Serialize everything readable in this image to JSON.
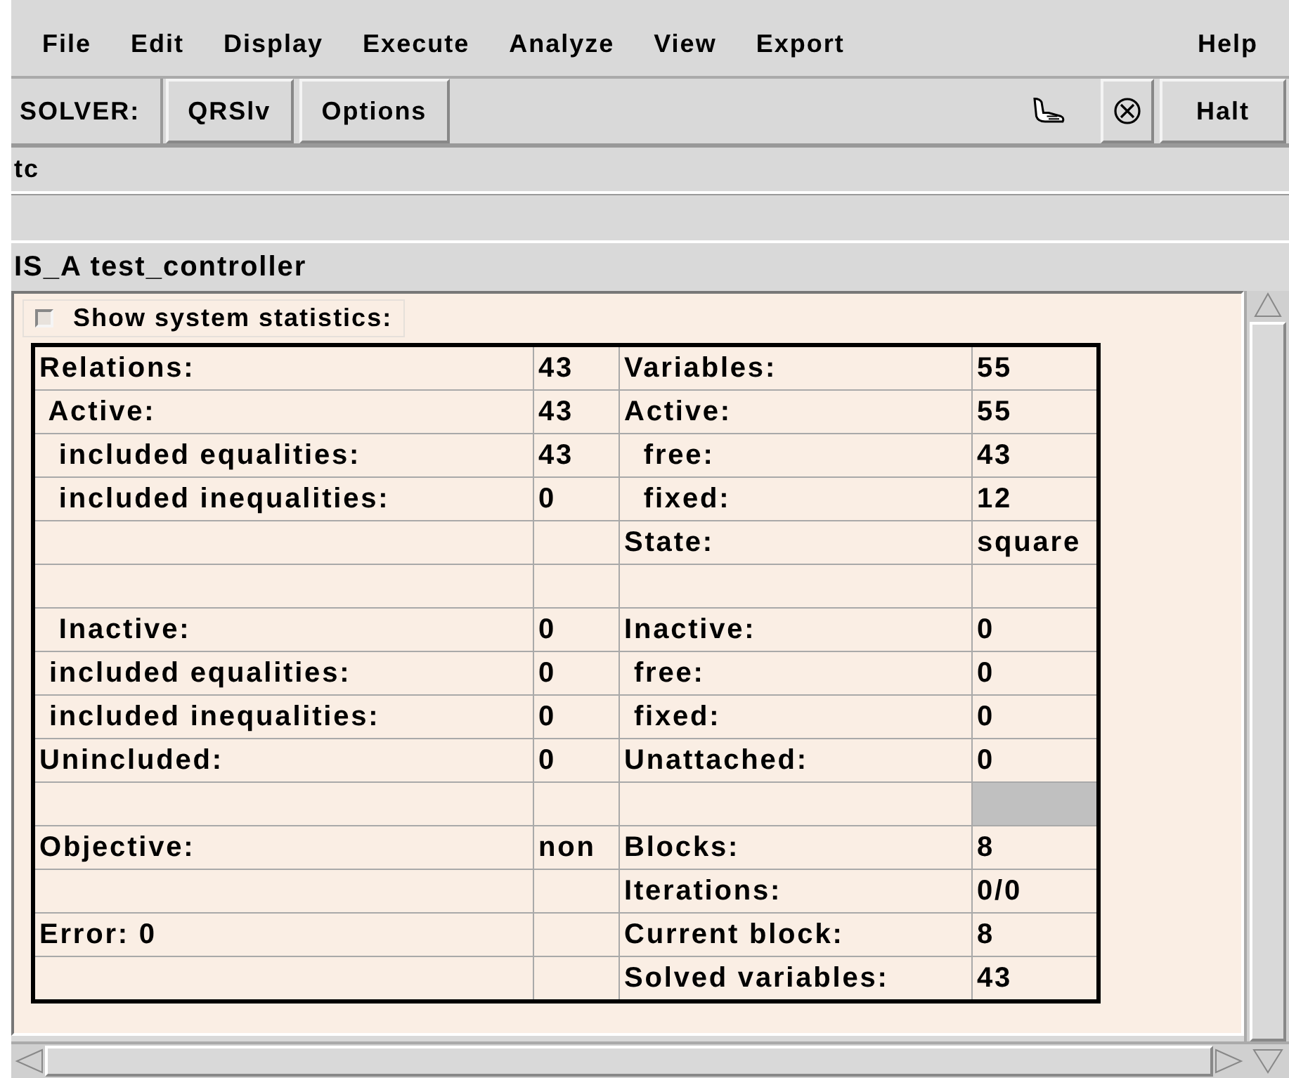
{
  "menu_bar": [
    "File",
    "Edit",
    "Display",
    "Execute",
    "Analyze",
    "View",
    "Export",
    "Help"
  ],
  "toolbar": {
    "label": "SOLVER:",
    "solver_button": "QRSlv",
    "options_button": "Options",
    "halt_button": "Halt"
  },
  "instance_field": {
    "value": "tc"
  },
  "type_line": "IS_A test_controller",
  "statistics": {
    "checkbox": {
      "label": "Show system statistics:",
      "checked": false
    },
    "rows": [
      {
        "cells": [
          "Relations:",
          "43",
          "Variables:",
          "55"
        ],
        "value_shaded": false
      },
      {
        "cells": [
          " Active:",
          "43",
          "Active:",
          "55"
        ],
        "value_shaded": false
      },
      {
        "cells": [
          "  included equalities:",
          "43",
          "  free:",
          "43"
        ],
        "value_shaded": false
      },
      {
        "cells": [
          "  included inequalities:",
          "0",
          "  fixed:",
          "12"
        ],
        "value_shaded": false
      },
      {
        "cells": [
          null,
          null,
          "State:",
          "square"
        ],
        "value_shaded": false
      },
      {
        "cells": [
          null,
          null,
          null,
          null
        ],
        "value_shaded": false
      },
      {
        "cells": [
          "  Inactive:",
          "0",
          "Inactive:",
          "0"
        ],
        "value_shaded": false
      },
      {
        "cells": [
          " included equalities:",
          "0",
          " free:",
          "0"
        ],
        "value_shaded": false
      },
      {
        "cells": [
          " included inequalities:",
          "0",
          " fixed:",
          "0"
        ],
        "value_shaded": false
      },
      {
        "cells": [
          "Unincluded:",
          "0",
          "Unattached:",
          "0"
        ],
        "value_shaded": false
      },
      {
        "cells": [
          null,
          null,
          null,
          null
        ],
        "value_shaded": true
      },
      {
        "cells": [
          "Objective:",
          "non",
          "Blocks:",
          "8"
        ],
        "value_shaded": false
      },
      {
        "cells": [
          null,
          null,
          "Iterations:",
          "0/0"
        ],
        "value_shaded": false
      },
      {
        "cells": [
          "Error: 0",
          null,
          "Current block:",
          "8"
        ],
        "value_shaded": false
      },
      {
        "cells": [
          null,
          null,
          "Solved variables:",
          "43"
        ],
        "value_shaded": false
      }
    ]
  }
}
